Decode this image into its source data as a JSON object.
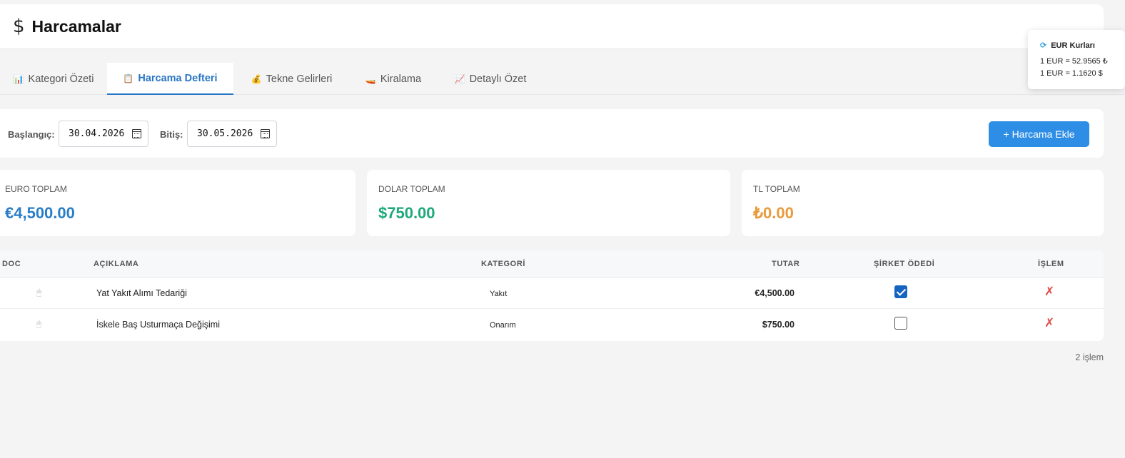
{
  "header": {
    "title": "Harcamalar",
    "icon": "dollar-icon"
  },
  "tabs": [
    {
      "label": "Kategori Özeti",
      "icon": "bar-chart-icon",
      "glyph": "📊"
    },
    {
      "label": "Harcama Defteri",
      "icon": "clipboard-icon",
      "glyph": "📋"
    },
    {
      "label": "Tekne Gelirleri",
      "icon": "money-bag-icon",
      "glyph": "💰"
    },
    {
      "label": "Kiralama",
      "icon": "boat-icon",
      "glyph": "🚤"
    },
    {
      "label": "Detaylı Özet",
      "icon": "line-chart-icon",
      "glyph": "📈"
    }
  ],
  "filter": {
    "start_label": "Başlangıç:",
    "start_value": "30.04.2026",
    "end_label": "Bitiş:",
    "end_value": "30.05.2026",
    "add_button": "+ Harcama Ekle"
  },
  "totals": [
    {
      "label": "EURO TOPLAM",
      "value": "€4,500.00",
      "color": "#2a7ec6"
    },
    {
      "label": "DOLAR TOPLAM",
      "value": "$750.00",
      "color": "#1fa97a"
    },
    {
      "label": "TL TOPLAM",
      "value": "₺0.00",
      "color": "#e89a3c"
    }
  ],
  "table": {
    "headers": {
      "doc": "DOC",
      "desc": "AÇIKLAMA",
      "cat": "KATEGORİ",
      "amount": "TUTAR",
      "paid": "ŞİRKET ÖDEDİ",
      "action": "İŞLEM"
    },
    "rows": [
      {
        "desc": "Yat Yakıt Alımı Tedariği",
        "cat": "Yakıt",
        "amount": "€4,500.00",
        "paid": true,
        "delete": "✗"
      },
      {
        "desc": "İskele Baş Usturmaça Değişimi",
        "cat": "Onarım",
        "amount": "$750.00",
        "paid": false,
        "delete": "✗"
      }
    ],
    "count": "2 işlem"
  },
  "rates": {
    "title": "EUR Kurları",
    "line1": "1 EUR = 52.9565 ₺",
    "line2": "1 EUR = 1.1620 $"
  }
}
